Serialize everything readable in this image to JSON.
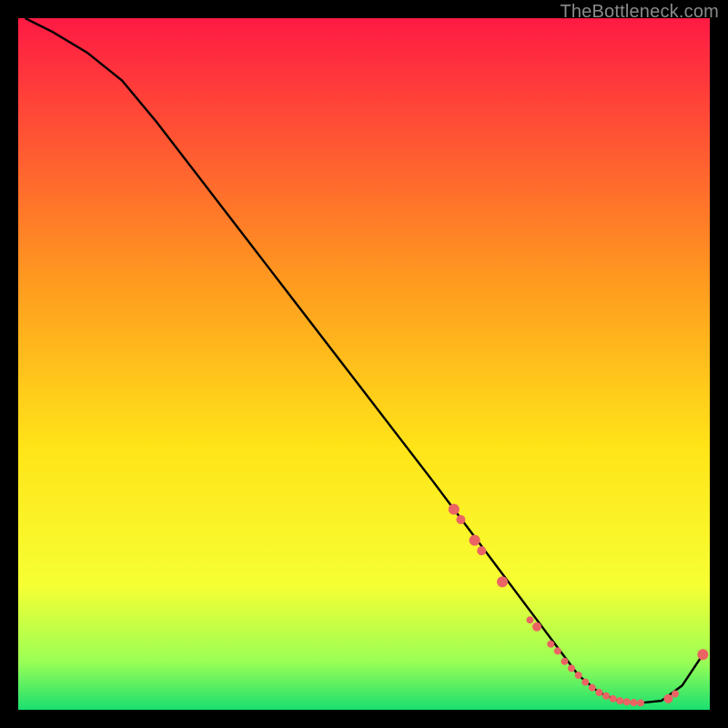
{
  "attribution": "TheBottleneck.com",
  "colors": {
    "black": "#000000",
    "curve": "#000000",
    "marker": "#eb6464",
    "grad_top": "#ff1a44",
    "grad_upper_mid": "#ff9a1f",
    "grad_mid": "#ffe418",
    "grad_lower_mid": "#f6ff33",
    "grad_near_bottom": "#9bff55",
    "grad_bottom": "#1adf6f"
  },
  "chart_data": {
    "type": "line",
    "title": "",
    "xlabel": "",
    "ylabel": "",
    "xlim": [
      0,
      100
    ],
    "ylim": [
      0,
      100
    ],
    "curve": {
      "x": [
        1,
        5,
        10,
        15,
        20,
        25,
        30,
        35,
        40,
        45,
        50,
        55,
        60,
        63,
        66,
        69,
        72,
        75,
        78,
        81,
        84,
        87,
        90,
        93,
        96,
        99
      ],
      "y": [
        100,
        98,
        95,
        91,
        85,
        78.5,
        72,
        65.5,
        59,
        52.5,
        46,
        39.5,
        33,
        29,
        25,
        21,
        17,
        13,
        9,
        5,
        2.5,
        1.2,
        1,
        1.3,
        3.5,
        8
      ]
    },
    "markers": {
      "x": [
        63,
        64,
        66,
        67,
        70,
        74,
        75,
        77,
        78,
        79,
        80,
        81,
        82,
        83,
        84,
        85,
        86,
        87,
        88,
        89,
        90,
        94,
        95,
        99
      ],
      "y": [
        29,
        27.5,
        24.5,
        23,
        18.5,
        13,
        12,
        9.5,
        8.5,
        7,
        6,
        5,
        4,
        3.2,
        2.5,
        2,
        1.6,
        1.3,
        1.15,
        1.05,
        1,
        1.6,
        2.3,
        8
      ],
      "r": [
        6,
        5,
        6,
        5,
        6,
        4,
        5,
        4,
        4,
        4,
        4,
        4,
        4,
        4,
        4,
        4,
        4,
        4,
        4,
        4,
        4,
        5,
        4,
        6
      ]
    }
  }
}
